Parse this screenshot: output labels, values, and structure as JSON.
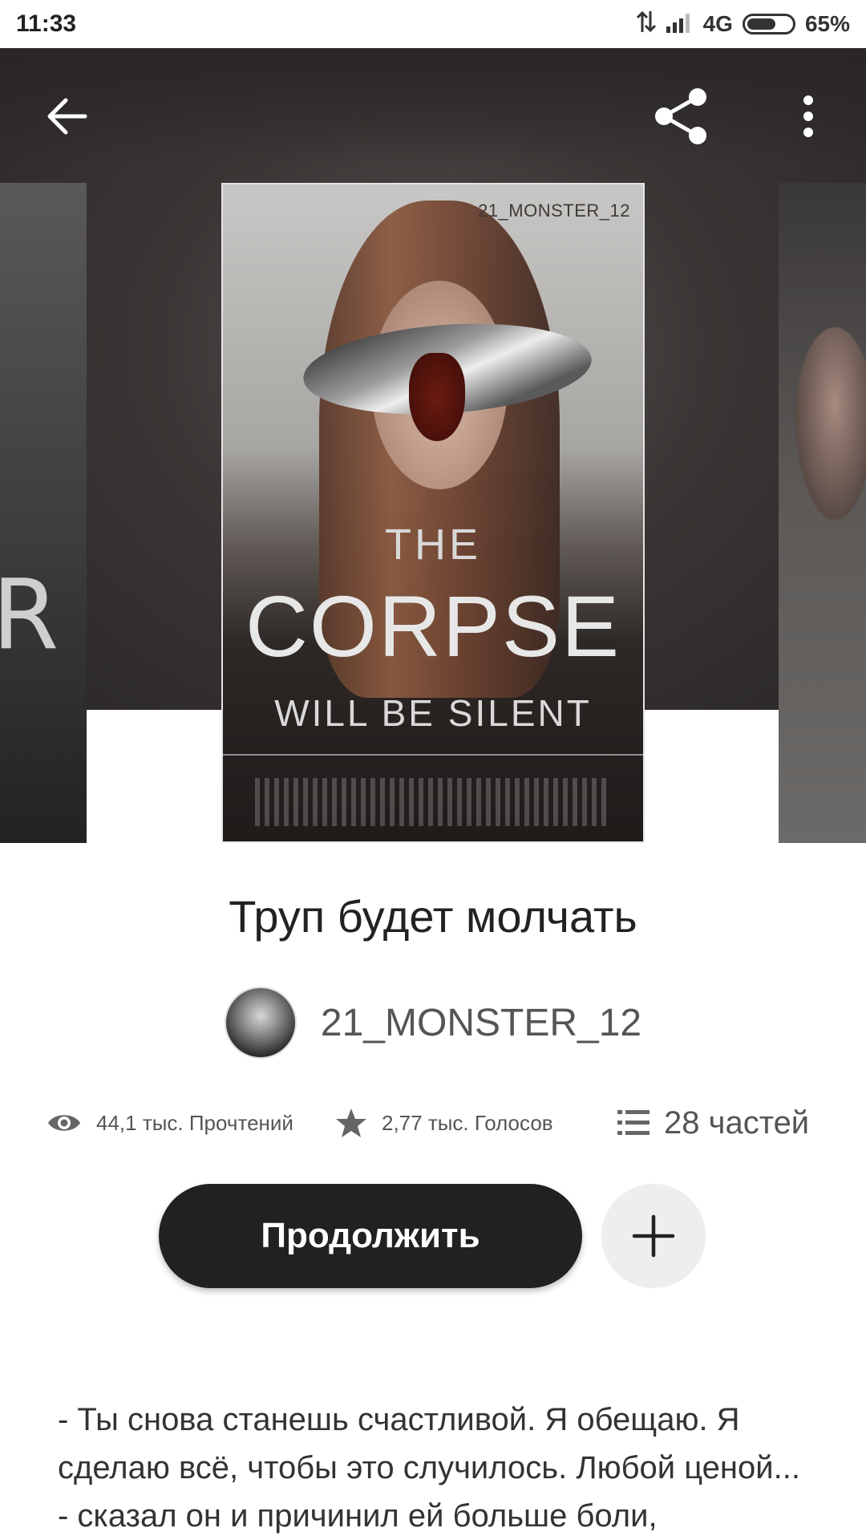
{
  "status_bar": {
    "time": "11:33",
    "network": "4G",
    "battery_percent": "65%",
    "battery_level": 0.65
  },
  "toolbar": {
    "back_icon": "arrow-left-icon",
    "share_icon": "share-icon",
    "more_icon": "more-vertical-icon"
  },
  "cover": {
    "author_mark": "21_MONSTER_12",
    "line1": "THE",
    "line2": "CORPSE",
    "line3": "WILL BE SILENT",
    "left_letter": "R"
  },
  "story": {
    "title": "Труп будет молчать",
    "author": "21_MONSTER_12"
  },
  "stats": {
    "reads": "44,1 тыс. Прочтений",
    "votes": "2,77 тыс. Голосов",
    "parts": "28 частей"
  },
  "actions": {
    "continue_label": "Продолжить",
    "add_icon": "plus-icon"
  },
  "description": {
    "text": "- Ты снова станешь счастливой. Я обещаю. Я сделаю всё, чтобы это случилось. Любой ценой... - сказал он и причинил ей больше боли,"
  },
  "colors": {
    "primary_button": "#222022",
    "secondary_button": "#eeedef",
    "text": "#222222",
    "muted": "#555555"
  }
}
